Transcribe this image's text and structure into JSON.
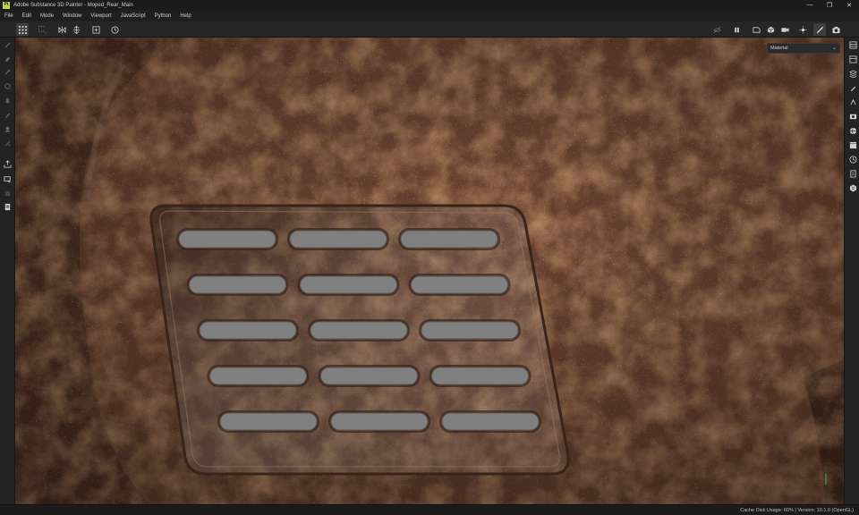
{
  "window": {
    "app_icon_text": "Pt",
    "title": "Adobe Substance 3D Painter - Moped_Rear_Main",
    "controls": {
      "minimize": "—",
      "maximize": "❐",
      "close": "✕"
    }
  },
  "menubar": {
    "items": [
      "File",
      "Edit",
      "Mode",
      "Window",
      "Viewport",
      "JavaScript",
      "Python",
      "Help"
    ]
  },
  "toolbar": {
    "left_tools": [
      "grid-icon",
      "dotted-grid-icon",
      "symmetry-icon",
      "align-icon",
      "add-frame-icon",
      "history-icon"
    ],
    "right_tools": [
      "hide-icon",
      "pause-icon",
      "view-icon",
      "cube-icon",
      "camera-icon",
      "light-icon",
      "paint-mode-icon",
      "screenshot-icon"
    ]
  },
  "left_tools": [
    "brush-icon",
    "eraser-icon",
    "projection-icon",
    "geometry-fill-icon",
    "smudge-icon",
    "clone-icon",
    "picker-icon",
    "fill-icon",
    "color-picker-icon",
    "bake-icon",
    "export-icon",
    "layers-icon",
    "stack-icon",
    "log-icon"
  ],
  "right_panels": [
    "layers-panel-icon",
    "texture-set-icon",
    "properties-icon",
    "brush-settings-icon",
    "display-icon",
    "environment-icon",
    "shelf-icon",
    "history-panel-icon",
    "log-panel-icon",
    "substance-icon"
  ],
  "viewport": {
    "channel_select": "Material",
    "colors": {
      "rust_base": "#6b4330",
      "rust_orange": "#b4602f",
      "metal": "#808080"
    },
    "vent_slots_per_row": 3,
    "vent_rows": 5
  },
  "statusbar": {
    "text": "Cache Disk Usage:   60% | Version: 10.1.0 (OpenGL)"
  }
}
